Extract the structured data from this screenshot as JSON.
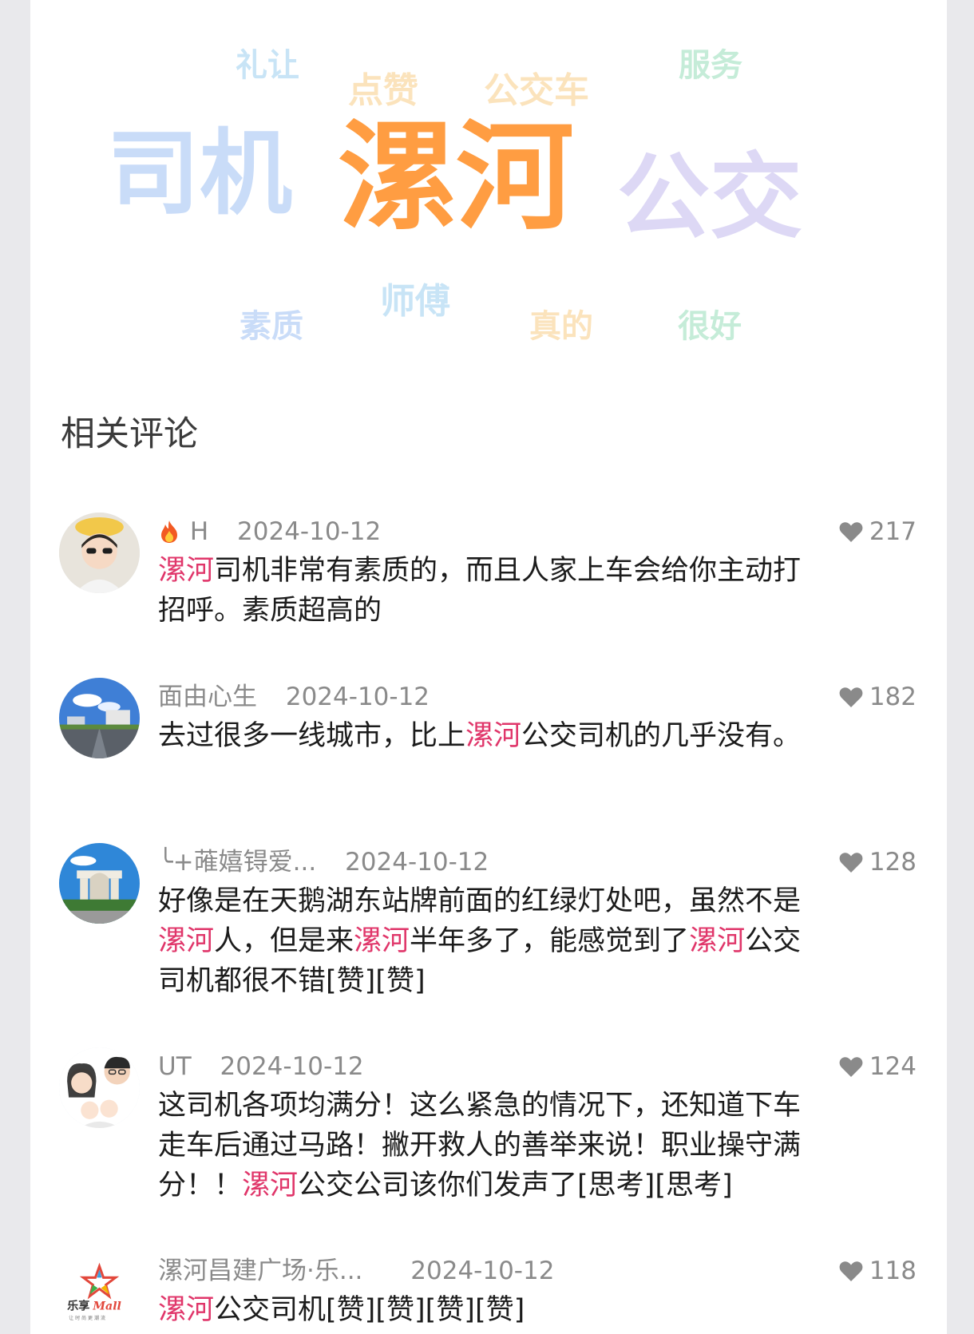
{
  "word_cloud": {
    "words": [
      {
        "text": "礼让",
        "color": "#c8e4f6"
      },
      {
        "text": "点赞",
        "color": "#fbe3bc"
      },
      {
        "text": "公交车",
        "color": "#fbe3bc"
      },
      {
        "text": "服务",
        "color": "#c5ecd8"
      },
      {
        "text": "司机",
        "color": "#c9dcf8"
      },
      {
        "text": "漯河",
        "color": "#ff9d42"
      },
      {
        "text": "公交",
        "color": "#ddd8f5"
      },
      {
        "text": "素质",
        "color": "#c9dcf8"
      },
      {
        "text": "师傅",
        "color": "#c8e4f6"
      },
      {
        "text": "真的",
        "color": "#fbe3bc"
      },
      {
        "text": "很好",
        "color": "#c5ecd8"
      }
    ]
  },
  "section_title": "相关评论",
  "highlight_color": "#e0366a",
  "comments": [
    {
      "user": "H",
      "fire_icon": "fire-emoji",
      "date": "2024-10-12",
      "likes": "217",
      "text": [
        {
          "t": "漯河",
          "hl": true
        },
        {
          "t": "司机非常有素质的，而且人家上车会给你主动打招呼。素质超高的"
        }
      ]
    },
    {
      "user": "面由心生",
      "date": "2024-10-12",
      "likes": "182",
      "text": [
        {
          "t": "去过很多一线城市，比上"
        },
        {
          "t": "漯河",
          "hl": true
        },
        {
          "t": "公交司机的几乎没有。"
        }
      ]
    },
    {
      "user": "╰+蓶嬉锝爱...",
      "date": "2024-10-12",
      "likes": "128",
      "text": [
        {
          "t": "好像是在天鹅湖东站牌前面的红绿灯处吧，虽然不是"
        },
        {
          "t": "漯河",
          "hl": true
        },
        {
          "t": "人，但是来"
        },
        {
          "t": "漯河",
          "hl": true
        },
        {
          "t": "半年多了，能感觉到了"
        },
        {
          "t": "漯河",
          "hl": true
        },
        {
          "t": "公交司机都很不错[赞][赞]"
        }
      ]
    },
    {
      "user": "UT",
      "date": "2024-10-12",
      "likes": "124",
      "text": [
        {
          "t": "这司机各项均满分！这么紧急的情况下，还知道下车走车后通过马路！撇开救人的善举来说！职业操守满分！！"
        },
        {
          "t": "漯河",
          "hl": true
        },
        {
          "t": "公交公司该你们发声了[思考][思考]"
        }
      ]
    },
    {
      "user": "漯河昌建广场·乐...",
      "date": "2024-10-12",
      "likes": "118",
      "avatar_logo": {
        "brand": "乐享",
        "brand_script": "Mall",
        "tagline": "让 时 尚 更 潮 流"
      },
      "text": [
        {
          "t": "漯河",
          "hl": true
        },
        {
          "t": "公交司机[赞][赞][赞][赞]"
        }
      ]
    }
  ]
}
